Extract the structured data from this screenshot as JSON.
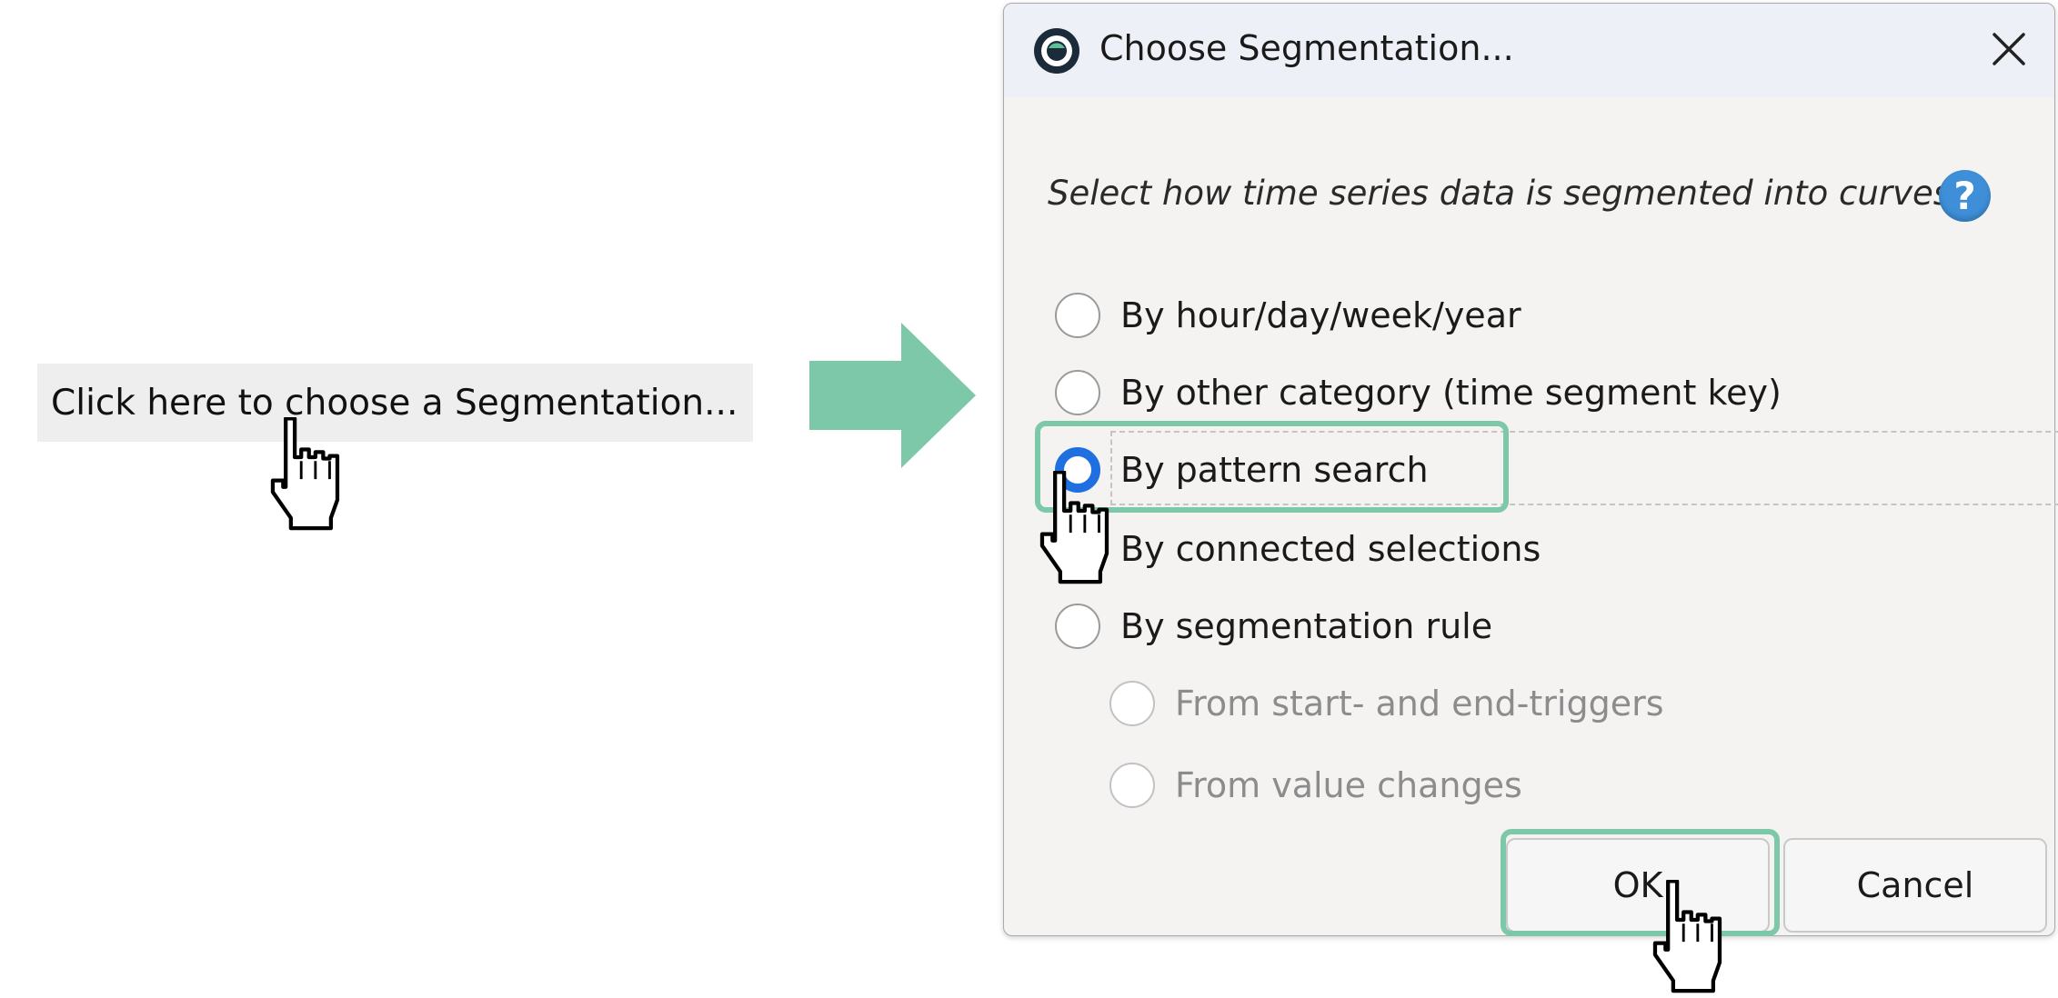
{
  "trigger": {
    "label": "Click here to choose a Segmentation..."
  },
  "dialog": {
    "title": "Choose Segmentation...",
    "prompt": "Select how time series data is segmented into curves:",
    "help_label": "?",
    "options": [
      {
        "label": "By hour/day/week/year",
        "checked": false,
        "enabled": true
      },
      {
        "label": "By other category (time segment key)",
        "checked": false,
        "enabled": true
      },
      {
        "label": "By pattern search",
        "checked": true,
        "enabled": true
      },
      {
        "label": "By connected selections",
        "checked": false,
        "enabled": true
      },
      {
        "label": "By segmentation rule",
        "checked": false,
        "enabled": true
      }
    ],
    "sub_options": [
      {
        "label": "From start- and end-triggers",
        "checked": false,
        "enabled": false
      },
      {
        "label": "From value changes",
        "checked": false,
        "enabled": false
      }
    ],
    "ok_label": "OK",
    "cancel_label": "Cancel"
  },
  "icons": {
    "app": "segmentation-app-icon",
    "close": "close-icon",
    "help": "help-icon",
    "arrow": "right-arrow-icon",
    "cursor": "hand-cursor-icon"
  },
  "colors": {
    "highlight": "#7cc8a8",
    "radio_checked": "#1f6fe0",
    "help_icon": "#3f8fd8",
    "titlebar": "#eef0f7",
    "dialog_bg": "#f4f3f2"
  }
}
